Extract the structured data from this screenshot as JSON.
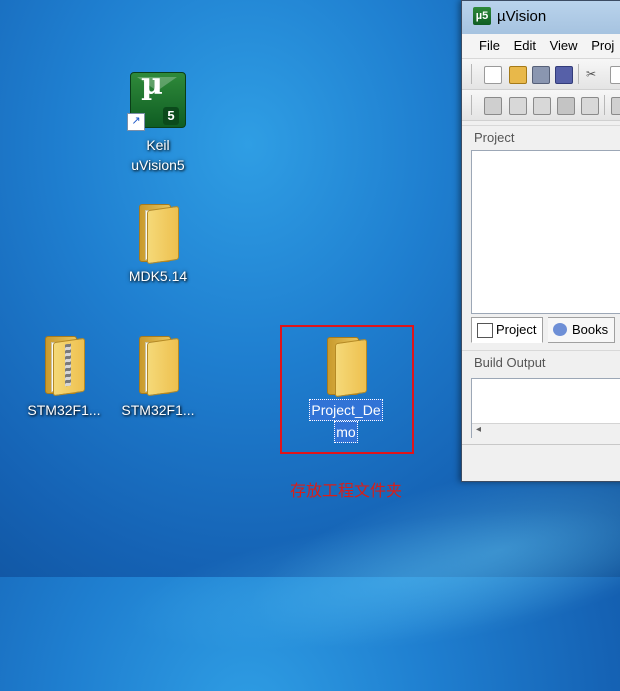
{
  "desktop": {
    "icons": [
      {
        "label_line1": "Keil",
        "label_line2": "uVision5",
        "type": "shortcut"
      },
      {
        "label": "MDK5.14",
        "type": "folder"
      },
      {
        "label": "STM32F1...",
        "type": "zip-folder"
      },
      {
        "label": "STM32F1...",
        "type": "folder"
      },
      {
        "label_line1": "Project_De",
        "label_line2": "mo",
        "type": "folder",
        "selected": true
      }
    ],
    "annotation": "存放工程文件夹",
    "annotation_color": "#d91e18",
    "highlight_color": "#e0141a"
  },
  "uvision": {
    "title": "µVision",
    "menu": [
      "File",
      "Edit",
      "View",
      "Proj"
    ],
    "project_pane_title": "Project",
    "tabs": [
      "Project",
      "Books"
    ],
    "build_output_title": "Build Output",
    "scroll_left": "◂"
  }
}
